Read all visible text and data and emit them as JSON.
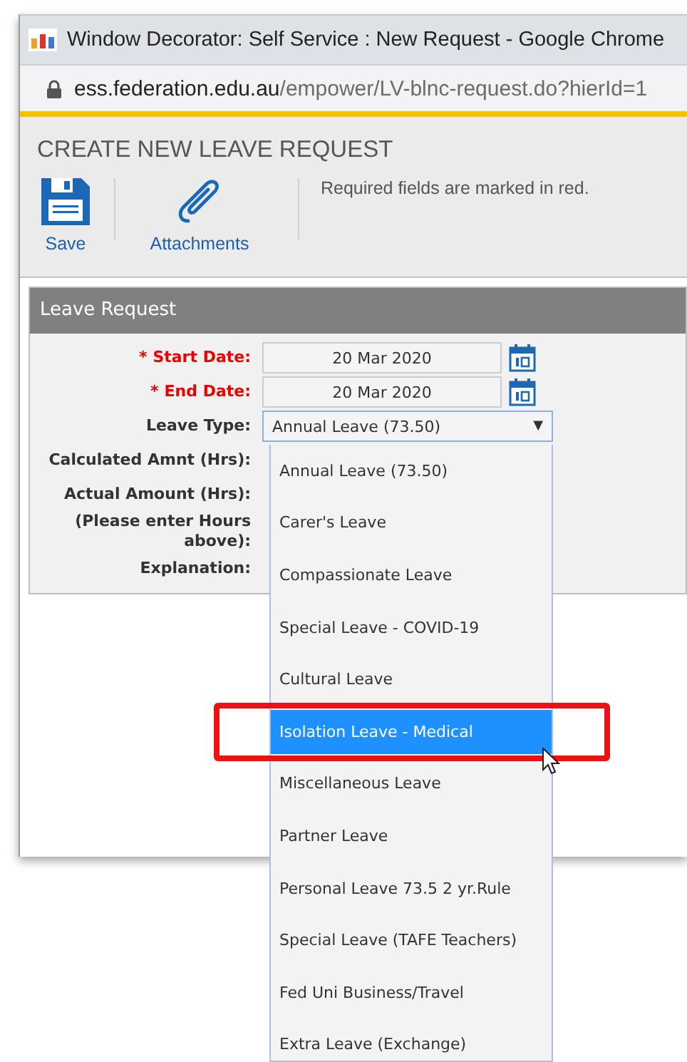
{
  "window": {
    "title": "Window Decorator: Self Service : New Request - Google Chrome"
  },
  "address_bar": {
    "host": "ess.federation.edu.au",
    "path": "/empower/LV-blnc-request.do?hierId=1"
  },
  "page_title": "CREATE NEW LEAVE REQUEST",
  "toolbar": [
    {
      "kind": "save",
      "label": "Save"
    },
    {
      "kind": "attach",
      "label": "Attachments"
    }
  ],
  "note": "Required fields are marked in red.",
  "panel": {
    "title": "Leave Request",
    "required_mark": "*",
    "fields": [
      {
        "kind": "date",
        "label": "Start Date:",
        "required": true,
        "value": "20 Mar 2020"
      },
      {
        "kind": "date",
        "label": "End Date:",
        "required": true,
        "value": "20 Mar 2020"
      },
      {
        "kind": "select",
        "label": "Leave Type:",
        "required": false,
        "value": "Annual Leave (73.50)",
        "arrow": "▼"
      },
      {
        "kind": "plain",
        "label": "Calculated Amnt (Hrs):",
        "required": false
      },
      {
        "kind": "plain",
        "label": "Actual Amount (Hrs):",
        "required": false
      },
      {
        "kind": "plain",
        "label": "(Please enter Hours above):",
        "required": false
      },
      {
        "kind": "plain",
        "label": "Explanation:",
        "required": false
      }
    ]
  },
  "dropdown": {
    "options": [
      {
        "label": "Annual Leave (73.50)",
        "selected": false
      },
      {
        "label": "Carer's Leave",
        "selected": false
      },
      {
        "label": "Compassionate Leave",
        "selected": false
      },
      {
        "label": "Special Leave - COVID-19",
        "selected": false
      },
      {
        "label": "Cultural Leave",
        "selected": false
      },
      {
        "label": "Isolation Leave - Medical",
        "selected": true
      },
      {
        "label": "Miscellaneous Leave",
        "selected": false
      },
      {
        "label": "Partner Leave",
        "selected": false
      },
      {
        "label": "Personal Leave 73.5 2 yr.Rule",
        "selected": false
      },
      {
        "label": "Special Leave (TAFE Teachers)",
        "selected": false
      },
      {
        "label": "Fed Uni Business/Travel",
        "selected": false
      },
      {
        "label": "Extra Leave (Exchange)",
        "selected": false
      }
    ]
  }
}
